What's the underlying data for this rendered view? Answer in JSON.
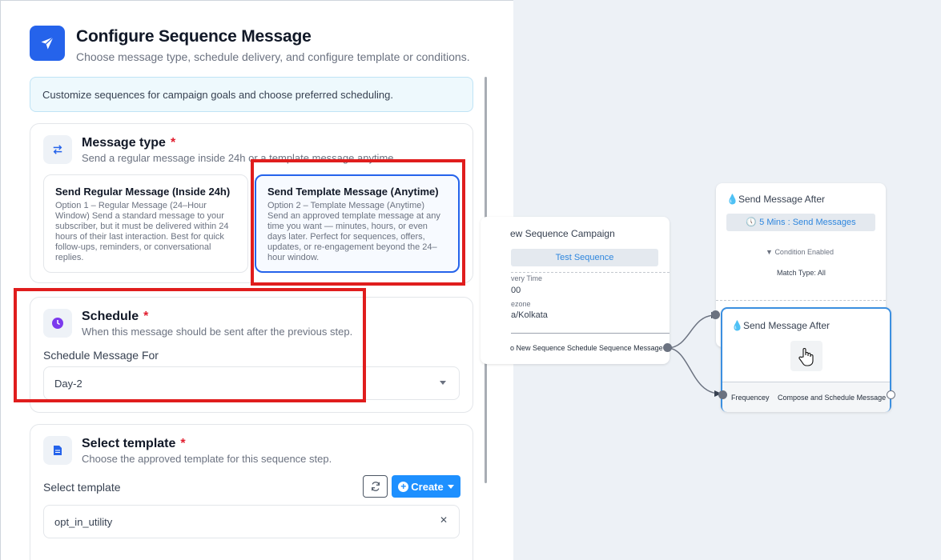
{
  "header": {
    "title": "Configure Sequence Message",
    "subtitle": "Choose message type, schedule delivery, and configure template or conditions."
  },
  "info_banner": "Customize sequences for campaign goals and choose preferred scheduling.",
  "message_type": {
    "title": "Message type",
    "required_mark": "*",
    "subtitle": "Send a regular message inside 24h or a template message anytime.",
    "options": [
      {
        "title": "Send Regular Message (Inside 24h)",
        "description": "Option 1 – Regular Message (24–Hour Window) Send a standard message to your subscriber, but it must be delivered within 24 hours of their last interaction. Best for quick follow-ups, reminders, or conversational replies.",
        "selected": false
      },
      {
        "title": "Send Template Message (Anytime)",
        "description": "Option 2 – Template Message (Anytime) Send an approved template message at any time you want — minutes, hours, or even days later. Perfect for sequences, offers, updates, or re-engagement beyond the 24–hour window.",
        "selected": true
      }
    ]
  },
  "schedule": {
    "title": "Schedule",
    "required_mark": "*",
    "subtitle": "When this message should be sent after the previous step.",
    "field_label": "Schedule Message For",
    "selected_value": "Day-2"
  },
  "template": {
    "title": "Select template",
    "required_mark": "*",
    "subtitle": "Choose the approved template for this sequence step.",
    "field_label": "Select template",
    "create_label": "Create",
    "selected_value": "opt_in_utility"
  },
  "canvas": {
    "campaign_node": {
      "title": "ew Sequence Campaign",
      "pill": "Test Sequence",
      "delivery_label": "very Time",
      "delivery_value": "00",
      "timezone_label": "ezone",
      "timezone_value": "a/Kolkata",
      "footer_left": "o New Sequence",
      "footer_right": "Schedule Sequence Message"
    },
    "send_after_node_1": {
      "title": "Send Message After",
      "pill": "5 Mins : Send Messages",
      "condition": "Condition Enabled",
      "match": "Match Type: All"
    },
    "send_after_node_2": {
      "title": "Send Message After",
      "footer_left": "Frequencey",
      "footer_right": "Compose and Schedule Message"
    }
  },
  "colors": {
    "primary": "#2563eb",
    "create_button": "#1e90ff",
    "required": "#e11d2e",
    "highlight_box": "#e01d1d",
    "canvas_bg": "#edf1f6",
    "pill_text": "#2e86de"
  }
}
